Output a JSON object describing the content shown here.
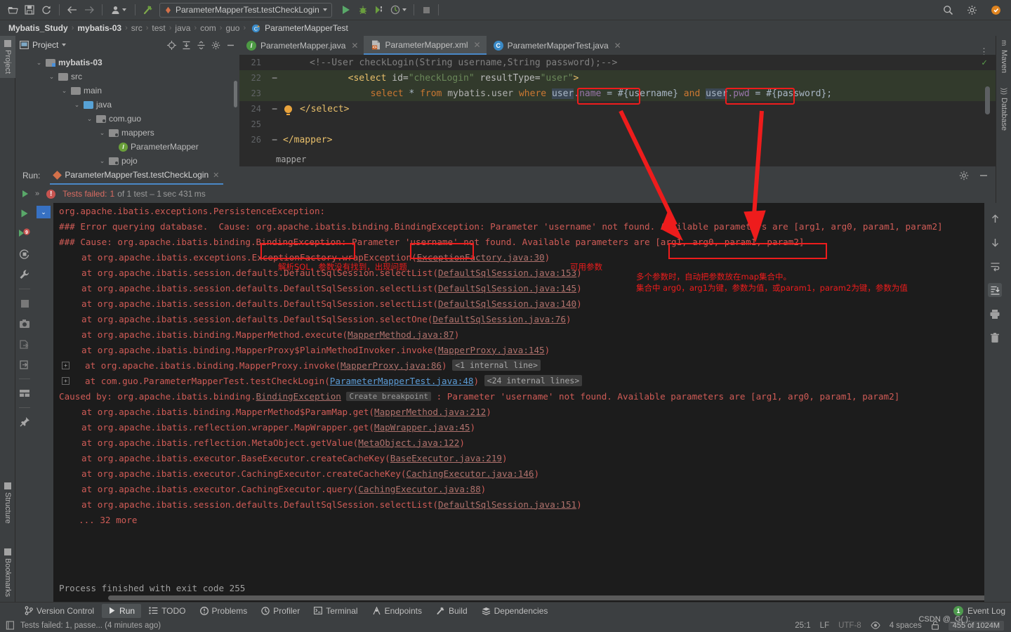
{
  "toolbar": {
    "icons": [
      "open-folder-icon",
      "save-icon",
      "sync-icon",
      "back-arrow-icon",
      "forward-arrow-icon",
      "user-profile-icon",
      "build-hammer-icon"
    ],
    "run_config": "ParameterMapperTest.testCheckLogin",
    "run_button": "run-button",
    "debug_button": "debug-button",
    "coverage_button": "run-with-coverage-button",
    "profile_button": "profile-button",
    "stop_button": "stop-button",
    "search_icon": "search-icon",
    "settings_icon": "gear-icon",
    "updates_icon": "updates-icon"
  },
  "breadcrumb": {
    "items": [
      "Mybatis_Study",
      "mybatis-03",
      "src",
      "test",
      "java",
      "com",
      "guo",
      "ParameterMapperTest"
    ],
    "separator": "›"
  },
  "left_strip": {
    "tabs": [
      {
        "label": "Project",
        "selected": true
      },
      {
        "label": "Structure",
        "selected": false
      },
      {
        "label": "Bookmarks",
        "selected": false
      }
    ]
  },
  "right_strip": {
    "tabs": [
      {
        "label": "Maven"
      },
      {
        "label": "Database"
      }
    ]
  },
  "project_panel": {
    "title": "Project",
    "tools": [
      "locate-icon",
      "expand-all-icon",
      "collapse-all-icon",
      "gear-icon",
      "minimize-icon"
    ],
    "tree": [
      {
        "label": "mybatis-03",
        "indent": 0,
        "chevron": "⌄",
        "icon": "module-folder",
        "bold": true
      },
      {
        "label": "src",
        "indent": 1,
        "chevron": "⌄",
        "icon": "folder",
        "bold": false
      },
      {
        "label": "main",
        "indent": 2,
        "chevron": "⌄",
        "icon": "folder",
        "bold": false
      },
      {
        "label": "java",
        "indent": 3,
        "chevron": "⌄",
        "icon": "source-folder",
        "bold": false
      },
      {
        "label": "com.guo",
        "indent": 4,
        "chevron": "⌄",
        "icon": "package",
        "bold": false
      },
      {
        "label": "mappers",
        "indent": 5,
        "chevron": "⌄",
        "icon": "package",
        "bold": false
      },
      {
        "label": "ParameterMapper",
        "indent": 6,
        "chevron": "",
        "icon": "interface",
        "bold": false
      },
      {
        "label": "pojo",
        "indent": 5,
        "chevron": "⌄",
        "icon": "package",
        "bold": false
      }
    ]
  },
  "editor": {
    "tabs": [
      {
        "label": "ParameterMapper.java",
        "icon": "java-interface-icon",
        "active": false
      },
      {
        "label": "ParameterMapper.xml",
        "icon": "xml-file-icon",
        "active": true
      },
      {
        "label": "ParameterMapperTest.java",
        "icon": "java-class-icon",
        "active": false
      }
    ],
    "more_icon": "more-options-icon",
    "inspection_status": "✓",
    "lines": [
      {
        "num": "21",
        "indent": 5,
        "segs": [
          {
            "t": "<!--User checkLogin(String username,String password);-->",
            "c": "cmt"
          }
        ],
        "highlight": false,
        "fold": ""
      },
      {
        "num": "22",
        "indent": 4,
        "segs": [
          {
            "t": "<select ",
            "c": "tag"
          },
          {
            "t": "id=",
            "c": "attr"
          },
          {
            "t": "\"checkLogin\"",
            "c": "str"
          },
          {
            "t": " resultType=",
            "c": "attr"
          },
          {
            "t": "\"user\"",
            "c": "str"
          },
          {
            "t": ">",
            "c": "tag"
          }
        ],
        "highlight": true,
        "fold": "-"
      },
      {
        "num": "23",
        "indent": 8,
        "segs": [
          {
            "t": "select ",
            "c": "sqlk"
          },
          {
            "t": "* ",
            "c": "plain"
          },
          {
            "t": "from ",
            "c": "sqlk"
          },
          {
            "t": "mybatis.user ",
            "c": "tbl"
          },
          {
            "t": "where ",
            "c": "sqlk"
          },
          {
            "t": "user",
            "c": "ident"
          },
          {
            "t": ".name",
            "c": "field"
          },
          {
            "t": " = ",
            "c": "plain"
          },
          {
            "t": "#{username}",
            "c": "plain"
          },
          {
            "t": " and ",
            "c": "sqlk"
          },
          {
            "t": "user",
            "c": "ident"
          },
          {
            "t": ".pwd",
            "c": "field"
          },
          {
            "t": " = ",
            "c": "plain"
          },
          {
            "t": "#{password};",
            "c": "plain"
          }
        ],
        "highlight": true,
        "fold": ""
      },
      {
        "num": "24",
        "indent": 4,
        "segs": [
          {
            "t": "</select>",
            "c": "tag"
          }
        ],
        "highlight": false,
        "fold": "bulb"
      },
      {
        "num": "25",
        "indent": 0,
        "segs": [],
        "highlight": false,
        "fold": ""
      },
      {
        "num": "26",
        "indent": 0,
        "segs": [
          {
            "t": "</mapper>",
            "c": "tag"
          }
        ],
        "highlight": false,
        "fold": "-"
      }
    ],
    "status_crumb": "mapper"
  },
  "run_panel": {
    "label": "Run:",
    "tab": "ParameterMapperTest.testCheckLogin",
    "close_icon": "close-icon",
    "settings_icon": "gear-icon",
    "minimize_icon": "minimize-icon",
    "status_prefix": "Tests failed:",
    "status_count": "1",
    "status_suffix": " of 1 test – 1 sec 431 ms",
    "expand_chevron": "»",
    "left_tools": [
      "rerun-icon",
      "rerun-failed-icon",
      "rerun-auto-icon",
      "settings-wrench-icon",
      "stop-icon",
      "screenshot-icon",
      "export-icon",
      "import-icon",
      "layout-icon",
      "pin-icon"
    ],
    "right_tools": [
      "scroll-up-icon",
      "scroll-down-icon",
      "soft-wrap-icon",
      "scroll-to-end-icon",
      "print-icon",
      "trash-icon"
    ],
    "console_lines": [
      {
        "indent": 0,
        "expander": false,
        "segs": [
          {
            "t": "org.apache.ibatis.exceptions.PersistenceException:",
            "c": "t"
          }
        ]
      },
      {
        "indent": 0,
        "expander": false,
        "segs": [
          {
            "t": "### Error querying database.  Cause: org.apache.ibatis.binding.BindingException: Parameter 'username' not found. Available parameters are [arg1, arg0, param1, param2]",
            "c": "t"
          }
        ]
      },
      {
        "indent": 0,
        "expander": false,
        "segs": [
          {
            "t": "### Cause: org.apache.ibatis.binding.BindingException: Parameter 'username' not found. Available parameters are [arg1, arg0, param1, param2]",
            "c": "t"
          }
        ]
      },
      {
        "indent": 1,
        "expander": false,
        "segs": [
          {
            "t": "at org.apache.ibatis.exceptions.ExceptionFactory.wrapException(",
            "c": "t"
          },
          {
            "t": "ExceptionFactory.java:30",
            "c": "lnk"
          },
          {
            "t": ")",
            "c": "t"
          }
        ]
      },
      {
        "indent": 1,
        "expander": false,
        "segs": [
          {
            "t": "at org.apache.ibatis.session.defaults.DefaultSqlSession.selectList(",
            "c": "t"
          },
          {
            "t": "DefaultSqlSession.java:153",
            "c": "lnk"
          },
          {
            "t": ")",
            "c": "t"
          }
        ]
      },
      {
        "indent": 1,
        "expander": false,
        "segs": [
          {
            "t": "at org.apache.ibatis.session.defaults.DefaultSqlSession.selectList(",
            "c": "t"
          },
          {
            "t": "DefaultSqlSession.java:145",
            "c": "lnk"
          },
          {
            "t": ")",
            "c": "t"
          }
        ]
      },
      {
        "indent": 1,
        "expander": false,
        "segs": [
          {
            "t": "at org.apache.ibatis.session.defaults.DefaultSqlSession.selectList(",
            "c": "t"
          },
          {
            "t": "DefaultSqlSession.java:140",
            "c": "lnk"
          },
          {
            "t": ")",
            "c": "t"
          }
        ]
      },
      {
        "indent": 1,
        "expander": false,
        "segs": [
          {
            "t": "at org.apache.ibatis.session.defaults.DefaultSqlSession.selectOne(",
            "c": "t"
          },
          {
            "t": "DefaultSqlSession.java:76",
            "c": "lnk"
          },
          {
            "t": ")",
            "c": "t"
          }
        ]
      },
      {
        "indent": 1,
        "expander": false,
        "segs": [
          {
            "t": "at org.apache.ibatis.binding.MapperMethod.execute(",
            "c": "t"
          },
          {
            "t": "MapperMethod.java:87",
            "c": "lnk"
          },
          {
            "t": ")",
            "c": "t"
          }
        ]
      },
      {
        "indent": 1,
        "expander": false,
        "segs": [
          {
            "t": "at org.apache.ibatis.binding.MapperProxy$PlainMethodInvoker.invoke(",
            "c": "t"
          },
          {
            "t": "MapperProxy.java:145",
            "c": "lnk"
          },
          {
            "t": ")",
            "c": "t"
          }
        ]
      },
      {
        "indent": 1,
        "expander": true,
        "segs": [
          {
            "t": "at org.apache.ibatis.binding.MapperProxy.invoke(",
            "c": "t"
          },
          {
            "t": "MapperProxy.java:86",
            "c": "lnk"
          },
          {
            "t": ") ",
            "c": "t"
          },
          {
            "t": "<1 internal line>",
            "c": "chip"
          }
        ]
      },
      {
        "indent": 1,
        "expander": true,
        "segs": [
          {
            "t": "at com.guo.ParameterMapperTest.testCheckLogin(",
            "c": "t"
          },
          {
            "t": "ParameterMapperTest.java:48",
            "c": "lnkb"
          },
          {
            "t": ") ",
            "c": "t"
          },
          {
            "t": "<24 internal lines>",
            "c": "chip"
          }
        ]
      },
      {
        "indent": 0,
        "expander": false,
        "segs": [
          {
            "t": "Caused by: org.apache.ibatis.binding.",
            "c": "t"
          },
          {
            "t": "BindingException",
            "c": "lnk"
          },
          {
            "t": " ",
            "c": "t"
          },
          {
            "t": "Create breakpoint",
            "c": "chip"
          },
          {
            "t": " : Parameter 'username' not found. Available parameters are [arg1, arg0, param1, param2]",
            "c": "t"
          }
        ]
      },
      {
        "indent": 1,
        "expander": false,
        "segs": [
          {
            "t": "at org.apache.ibatis.binding.MapperMethod$ParamMap.get(",
            "c": "t"
          },
          {
            "t": "MapperMethod.java:212",
            "c": "lnk"
          },
          {
            "t": ")",
            "c": "t"
          }
        ]
      },
      {
        "indent": 1,
        "expander": false,
        "segs": [
          {
            "t": "at org.apache.ibatis.reflection.wrapper.MapWrapper.get(",
            "c": "t"
          },
          {
            "t": "MapWrapper.java:45",
            "c": "lnk"
          },
          {
            "t": ")",
            "c": "t"
          }
        ]
      },
      {
        "indent": 1,
        "expander": false,
        "segs": [
          {
            "t": "at org.apache.ibatis.reflection.MetaObject.getValue(",
            "c": "t"
          },
          {
            "t": "MetaObject.java:122",
            "c": "lnk"
          },
          {
            "t": ")",
            "c": "t"
          }
        ]
      },
      {
        "indent": 1,
        "expander": false,
        "segs": [
          {
            "t": "at org.apache.ibatis.executor.BaseExecutor.createCacheKey(",
            "c": "t"
          },
          {
            "t": "BaseExecutor.java:219",
            "c": "lnk"
          },
          {
            "t": ")",
            "c": "t"
          }
        ]
      },
      {
        "indent": 1,
        "expander": false,
        "segs": [
          {
            "t": "at org.apache.ibatis.executor.CachingExecutor.createCacheKey(",
            "c": "t"
          },
          {
            "t": "CachingExecutor.java:146",
            "c": "lnk"
          },
          {
            "t": ")",
            "c": "t"
          }
        ]
      },
      {
        "indent": 1,
        "expander": false,
        "segs": [
          {
            "t": "at org.apache.ibatis.executor.CachingExecutor.query(",
            "c": "t"
          },
          {
            "t": "CachingExecutor.java:88",
            "c": "lnk"
          },
          {
            "t": ")",
            "c": "t"
          }
        ]
      },
      {
        "indent": 1,
        "expander": false,
        "segs": [
          {
            "t": "at org.apache.ibatis.session.defaults.DefaultSqlSession.selectList(",
            "c": "t"
          },
          {
            "t": "DefaultSqlSession.java:151",
            "c": "lnk"
          },
          {
            "t": ")",
            "c": "t"
          }
        ]
      },
      {
        "indent": 1,
        "expander": false,
        "segs": [
          {
            "t": "... 32 more",
            "c": "t"
          }
        ]
      }
    ],
    "process_finished": "Process finished with exit code 255"
  },
  "annotations": [
    {
      "id": "anno-parse-sql",
      "text": "解析SQL，参数没有找到，出现问题"
    },
    {
      "id": "anno-available-params",
      "text": "可用参数"
    },
    {
      "id": "anno-multi-param-line1",
      "text": "多个参数时，自动把参数放在map集合中。"
    },
    {
      "id": "anno-multi-param-line2",
      "text": "集合中 arg0，arg1为键，参数为值，或param1，param2为键，参数为值"
    }
  ],
  "bottom_bar": {
    "items": [
      {
        "label": "Version Control",
        "icon": "branch-icon",
        "selected": false
      },
      {
        "label": "Run",
        "icon": "run-icon",
        "selected": true
      },
      {
        "label": "TODO",
        "icon": "todo-icon",
        "selected": false
      },
      {
        "label": "Problems",
        "icon": "problems-icon",
        "selected": false
      },
      {
        "label": "Profiler",
        "icon": "profiler-icon",
        "selected": false
      },
      {
        "label": "Terminal",
        "icon": "terminal-icon",
        "selected": false
      },
      {
        "label": "Endpoints",
        "icon": "endpoints-icon",
        "selected": false
      },
      {
        "label": "Build",
        "icon": "build-icon",
        "selected": false
      },
      {
        "label": "Dependencies",
        "icon": "dependencies-icon",
        "selected": false
      }
    ],
    "event_log": "Event Log",
    "event_count": "1"
  },
  "status_bar": {
    "message": "Tests failed: 1, passe... (4 minutes ago)",
    "caret": "25:1",
    "line_sep": "LF",
    "encoding": "UTF-8",
    "indent": "4 spaces",
    "memory": "455 of 1024M",
    "lock_icon": "unlocked-icon",
    "inspection_icon": "eye-icon"
  },
  "watermark": "CSDN @_G(  ):",
  "colors": {
    "accent_blue": "#4a88c7",
    "error_red": "#cf5b56",
    "annotation_red": "#ee1c1c",
    "green": "#59a869",
    "panel_bg": "#3c3f41",
    "editor_bg": "#2b2b2b",
    "console_bg": "#1c1c1c"
  }
}
